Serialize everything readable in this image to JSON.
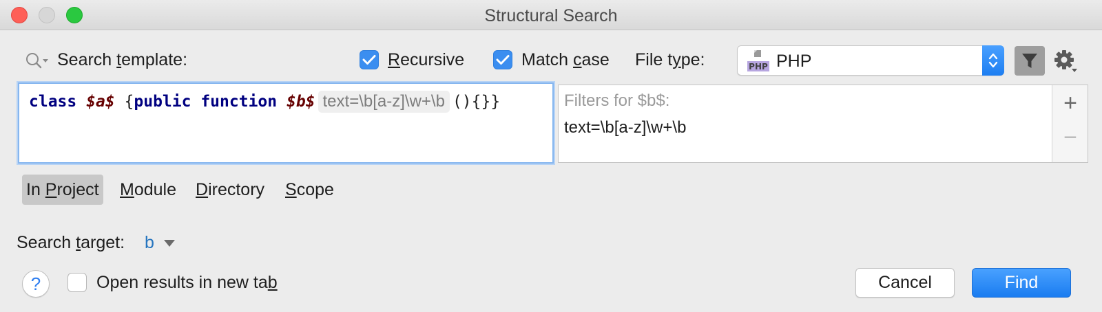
{
  "window": {
    "title": "Structural Search"
  },
  "search": {
    "template_label_before": "Search ",
    "template_label_mnemonic": "t",
    "template_label_after": "emplate:",
    "recursive": {
      "checked": true,
      "mnemonic": "R",
      "rest": "ecursive"
    },
    "match_case": {
      "checked": true,
      "before": "Match ",
      "mnemonic": "c",
      "after": "ase"
    },
    "file_type_label_before": "File t",
    "file_type_label_mnemonic": "y",
    "file_type_label_after": "pe:",
    "file_type_value": "PHP",
    "file_type_icon_text": "PHP"
  },
  "editor": {
    "tokens": {
      "kw_class": "class",
      "var_a": "$a$",
      "brace_open": "{",
      "kw_public": "public",
      "kw_function": "function",
      "var_b": "$b$",
      "inlay": "text=\\b[a-z]\\w+\\b",
      "tail": "(){}}"
    }
  },
  "filters": {
    "title": "Filters for $b$:",
    "value": "text=\\b[a-z]\\w+\\b",
    "add_label": "+",
    "remove_label": "−"
  },
  "scope": {
    "tabs": [
      {
        "before": "In ",
        "mnemonic": "P",
        "after": "roject",
        "active": true
      },
      {
        "before": "",
        "mnemonic": "M",
        "after": "odule",
        "active": false
      },
      {
        "before": "",
        "mnemonic": "D",
        "after": "irectory",
        "active": false
      },
      {
        "before": "",
        "mnemonic": "S",
        "after": "cope",
        "active": false
      }
    ]
  },
  "target": {
    "label_before": "Search ",
    "label_mnemonic": "t",
    "label_after": "arget:",
    "value": "b"
  },
  "footer": {
    "help_label": "?",
    "open_new_tab": {
      "checked": false,
      "before": "Open results in new ta",
      "mnemonic": "b"
    },
    "cancel_label": "Cancel",
    "find_label": "Find"
  },
  "colors": {
    "accent": "#1a7cf0",
    "keyword": "#000080",
    "template_var": "#660000",
    "link": "#2675bf"
  },
  "icons": [
    "search-icon",
    "check-icon",
    "php-file-icon",
    "updown-arrow-icon",
    "filter-icon",
    "gear-icon",
    "plus-icon",
    "minus-icon",
    "dropdown-arrow-icon",
    "help-icon"
  ]
}
